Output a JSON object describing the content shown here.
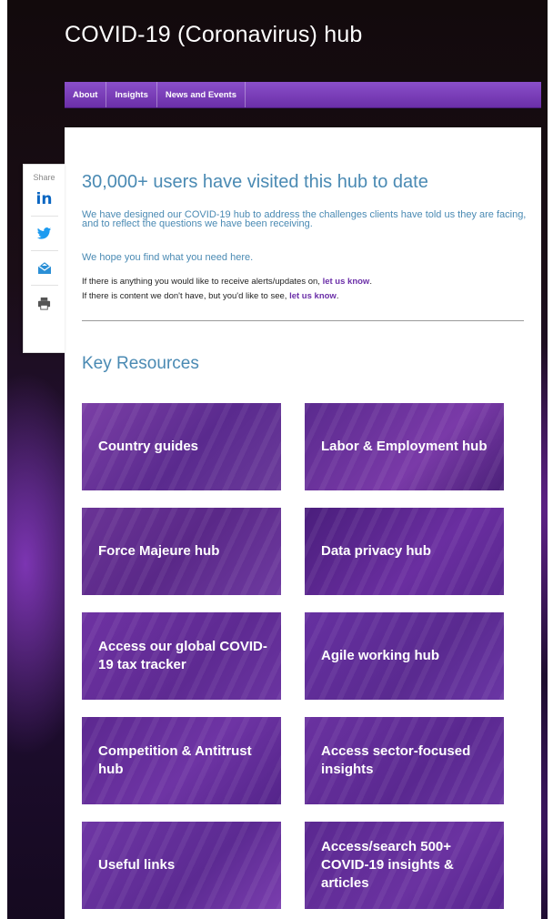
{
  "header": {
    "title": "COVID-19 (Coronavirus) hub"
  },
  "nav": {
    "items": [
      "About",
      "Insights",
      "News and Events"
    ]
  },
  "share": {
    "label": "Share",
    "icons": [
      "linkedin-icon",
      "twitter-icon",
      "email-icon",
      "print-icon"
    ],
    "linkedin_text": "in"
  },
  "main": {
    "headline": "30,000+ users have visited this hub to date",
    "intro": "We have designed our COVID-19 hub to address the challenges clients have told us they are facing, and to reflect the questions we have been receiving.",
    "hope": "We hope you find what you need here.",
    "alerts_text": "If there is anything you would like to receive alerts/updates on, ",
    "alerts_link": "let us know",
    "content_text": "If there is content we don't have, but you'd like to see, ",
    "content_link": "let us know",
    "period": "."
  },
  "resources": {
    "title": "Key Resources",
    "tiles": [
      "Country guides",
      "Labor & Employment hub",
      "Force Majeure hub",
      "Data privacy hub",
      "Access our global COVID-19 tax tracker",
      "Agile working hub",
      "Competition & Antitrust hub",
      "Access sector-focused insights",
      "Useful links",
      "Access/search 500+ COVID-19 insights & articles"
    ]
  },
  "colors": {
    "accent_purple": "#6b2fa8",
    "heading_blue": "#4a8ab3",
    "linkedin": "#0a66c2",
    "twitter": "#1d9bf0"
  }
}
